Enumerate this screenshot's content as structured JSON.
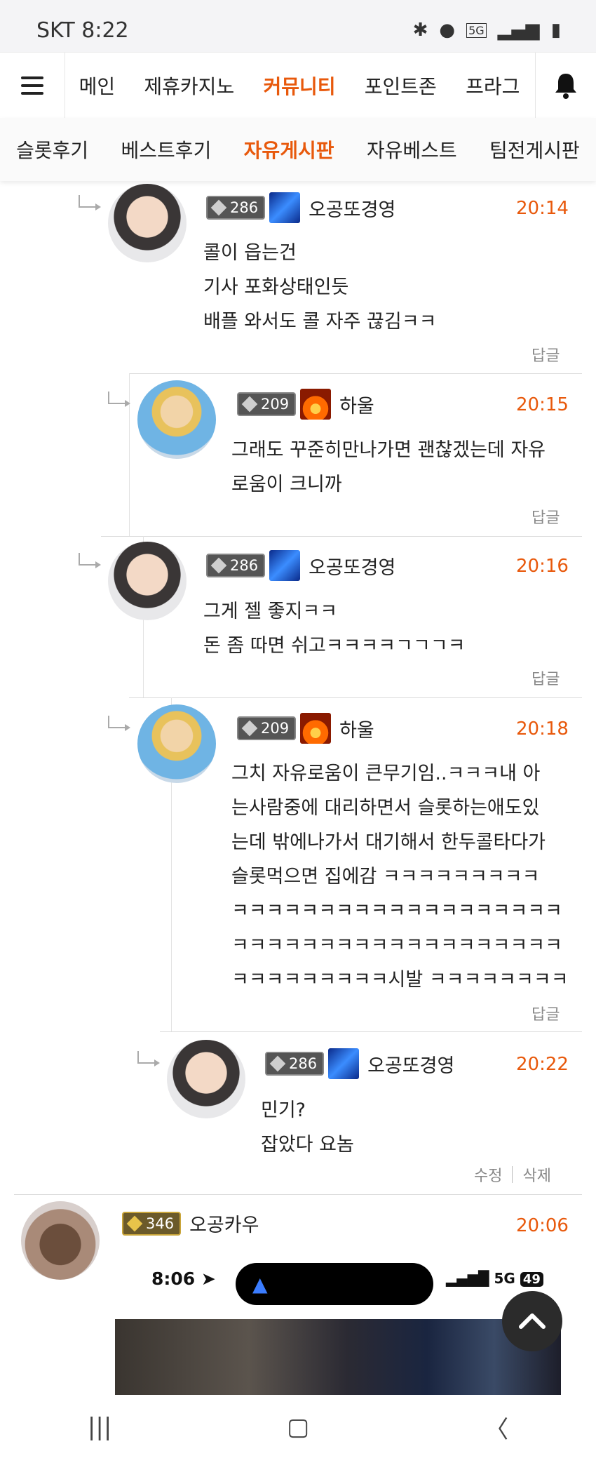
{
  "status_bar": {
    "carrier_time": "SKT 8:22",
    "icons": [
      "bluetooth-icon",
      "location-icon",
      "5g-icon",
      "signal-icon",
      "battery-icon"
    ],
    "network": "5G"
  },
  "top_nav": {
    "items": [
      "메인",
      "제휴카지노",
      "커뮤니티",
      "포인트존",
      "프라그"
    ],
    "active": "커뮤니티"
  },
  "sub_nav": {
    "items": [
      "슬롯후기",
      "베스트후기",
      "자유게시판",
      "자유베스트",
      "팀전게시판"
    ],
    "active": "자유게시판"
  },
  "comments": [
    {
      "level": "286",
      "nickname": "오공또경영",
      "time": "20:14",
      "lines": [
        "콜이 읍는건",
        "기사 포화상태인듯",
        "배플 와서도 콜 자주 끊김ㅋㅋ"
      ],
      "reply_label": "답글"
    },
    {
      "level": "209",
      "nickname": "하울",
      "time": "20:15",
      "lines": [
        "그래도 꾸준히만나가면 괜찮겠는데 자유",
        "로움이 크니까"
      ],
      "reply_label": "답글"
    },
    {
      "level": "286",
      "nickname": "오공또경영",
      "time": "20:16",
      "lines": [
        "그게 젤 좋지ㅋㅋ",
        "돈 좀 따면 쉬고ㅋㅋㅋㅋㄱㄱㄱㅋ"
      ],
      "reply_label": "답글"
    },
    {
      "level": "209",
      "nickname": "하울",
      "time": "20:18",
      "lines": [
        "그치 자유로움이 큰무기임..ㅋㅋㅋ내 아",
        "는사람중에 대리하면서 슬롯하는애도있",
        "는데 밖에나가서 대기해서 한두콜타다가",
        "슬롯먹으면 집에감 ㅋㅋㅋㅋㅋㅋㅋㅋㅋ",
        "ㅋㅋㅋㅋㅋㅋㅋㅋㅋㅋㅋㅋㅋㅋㅋㅋㅋㅋㅋ",
        "ㅋㅋㅋㅋㅋㅋㅋㅋㅋㅋㅋㅋㅋㅋㅋㅋㅋㅋㅋ",
        "ㅋㅋㅋㅋㅋㅋㅋㅋㅋ시발 ㅋㅋㅋㅋㅋㅋㅋㅋ"
      ],
      "reply_label": "답글"
    },
    {
      "level": "286",
      "nickname": "오공또경영",
      "time": "20:22",
      "lines": [
        "민기?",
        "잡았다 요놈"
      ],
      "edit_label": "수정",
      "delete_label": "삭제"
    },
    {
      "level": "346",
      "nickname": "오공카우",
      "time": "20:06"
    }
  ],
  "embedded_screenshot": {
    "time": "8:06",
    "network": "5G",
    "battery": "49"
  },
  "colors": {
    "accent": "#e8590c",
    "text": "#222222",
    "muted": "#888888"
  }
}
